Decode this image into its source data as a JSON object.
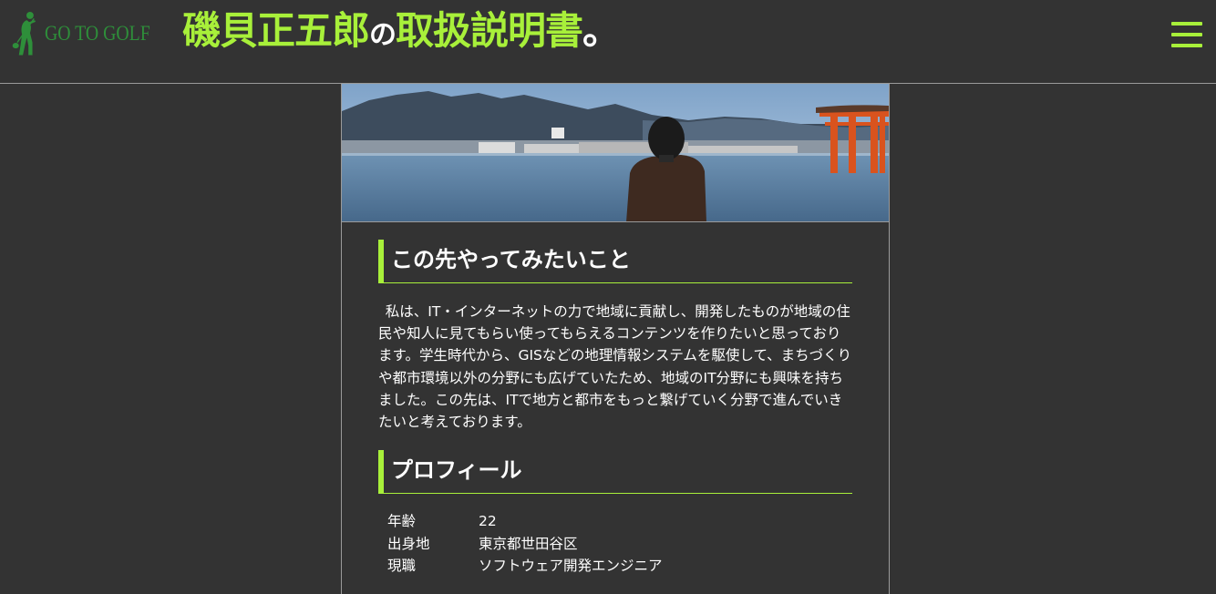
{
  "header": {
    "logo_text": "GO TO GOLF",
    "title_name": "磯貝正五郎",
    "title_particle": "の",
    "title_rest": "取扱説明書",
    "title_end": "。"
  },
  "menu": {
    "icon": "hamburger-menu-icon"
  },
  "hero": {
    "alt": "宮島の海辺と大鳥居を眺める人物の後ろ姿"
  },
  "sections": {
    "future": {
      "heading": "この先やってみたいこと",
      "body": "私は、IT・インターネットの力で地域に貢献し、開発したものが地域の住民や知人に見てもらい使ってもらえるコンテンツを作りたいと思っております。学生時代から、GISなどの地理情報システムを駆使して、まちづくりや都市環境以外の分野にも広げていたため、地域のIT分野にも興味を持ちました。この先は、ITで地方と都市をもっと繋げていく分野で進んでいきたいと考えております。"
    },
    "profile": {
      "heading": "プロフィール",
      "rows": [
        {
          "key": "年齢",
          "value": "22"
        },
        {
          "key": "出身地",
          "value": "東京都世田谷区"
        },
        {
          "key": "現職",
          "value": "ソフトウェア開発エンジニア"
        }
      ]
    }
  },
  "colors": {
    "background": "#333333",
    "accent": "#a8f03a",
    "logo_green": "#2e8f3a",
    "border": "#9a9a9a"
  }
}
